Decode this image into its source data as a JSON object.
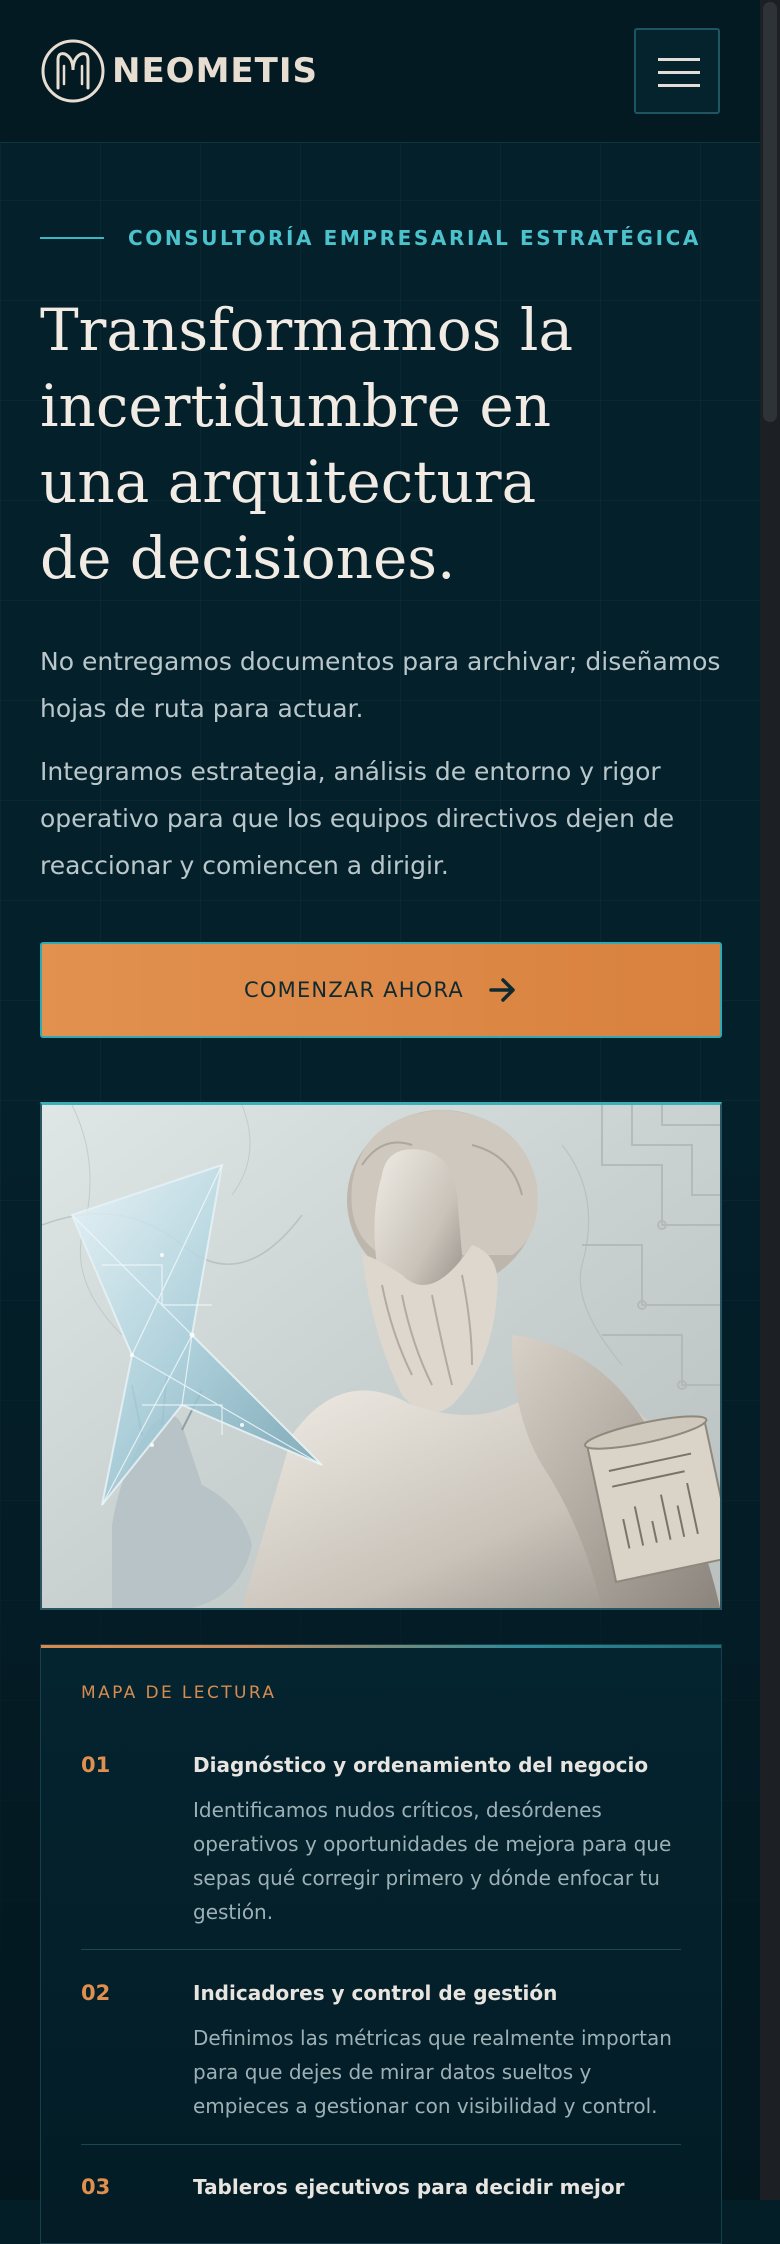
{
  "header": {
    "brand": "NEOMETIS",
    "menu_icon": "hamburger-menu-icon"
  },
  "hero": {
    "eyebrow": "CONSULTORÍA EMPRESARIAL ESTRATÉGICA",
    "title_lines": [
      "Transformamos la",
      "incertidumbre en",
      "una arquitectura",
      "de decisiones."
    ],
    "lead_1_lines": [
      "No entregamos documentos para archivar; diseñamos",
      "hojas de ruta para actuar."
    ],
    "lead_2_lines": [
      "Integramos estrategia, análisis de entorno y rigor",
      "operativo para que los equipos directivos dejen de",
      "reaccionar y comiencen a dirigir."
    ],
    "cta_label": "COMENZAR AHORA",
    "cta_icon": "arrow-right-icon",
    "image_subject": "marble-statue-with-crystal-star-image"
  },
  "reading_map": {
    "heading": "MAPA DE LECTURA",
    "items": [
      {
        "number": "01",
        "title": "Diagnóstico y ordenamiento del negocio",
        "desc_lines": [
          "Identificamos nudos críticos, desórdenes",
          "operativos y oportunidades de mejora para que",
          "sepas qué corregir primero y dónde enfocar tu",
          "gestión."
        ]
      },
      {
        "number": "02",
        "title": "Indicadores y control de gestión",
        "desc_lines": [
          "Definimos las métricas que realmente importan",
          "para que dejes de mirar datos sueltos y",
          "empieces a gestionar con visibilidad y control."
        ]
      },
      {
        "number": "03",
        "title": "Tableros ejecutivos para decidir mejor",
        "desc_lines": []
      }
    ]
  },
  "colors": {
    "background": "#04202b",
    "accent_teal": "#3bb7c2",
    "accent_orange": "#df8f4e",
    "heading_text": "#f1ebe4"
  }
}
